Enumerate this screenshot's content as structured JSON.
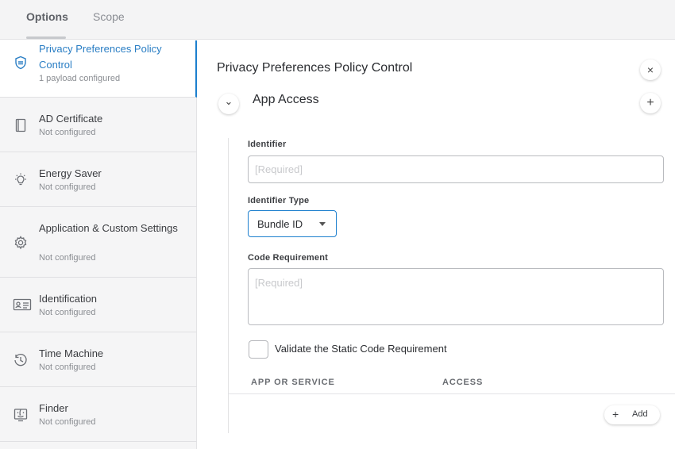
{
  "tabs": [
    {
      "label": "Options",
      "active": true
    },
    {
      "label": "Scope",
      "active": false
    }
  ],
  "sidebar": {
    "items": [
      {
        "title": "Privacy Preferences Policy Control",
        "status": "1 payload configured",
        "icon": "shield-icon",
        "active": true
      },
      {
        "title": "AD Certificate",
        "status": "Not configured",
        "icon": "certificate-icon"
      },
      {
        "title": "Energy Saver",
        "status": "Not configured",
        "icon": "lightbulb-icon"
      },
      {
        "title": "Application & Custom Settings",
        "status": "Not configured",
        "icon": "gear-icon"
      },
      {
        "title": "Identification",
        "status": "Not configured",
        "icon": "id-card-icon"
      },
      {
        "title": "Time Machine",
        "status": "Not configured",
        "icon": "clock-history-icon"
      },
      {
        "title": "Finder",
        "status": "Not configured",
        "icon": "finder-icon"
      }
    ]
  },
  "main": {
    "title": "Privacy Preferences Policy Control",
    "close_glyph": "×",
    "section": {
      "title": "App Access",
      "collapse_glyph": "⌄",
      "add_glyph": "+"
    },
    "identifier": {
      "label": "Identifier",
      "value": "",
      "placeholder": "[Required]"
    },
    "identifier_type": {
      "label": "Identifier Type",
      "value": "Bundle ID"
    },
    "code_requirement": {
      "label": "Code Requirement",
      "value": "",
      "placeholder": "[Required]"
    },
    "validate": {
      "label": "Validate the Static Code Requirement",
      "checked": false
    },
    "table": {
      "columns": [
        "APP OR SERVICE",
        "ACCESS"
      ]
    },
    "add_button": {
      "plus": "+",
      "label": "Add"
    }
  },
  "colors": {
    "accent": "#1c7fce",
    "sidebar_bg": "#f5f5f6"
  }
}
